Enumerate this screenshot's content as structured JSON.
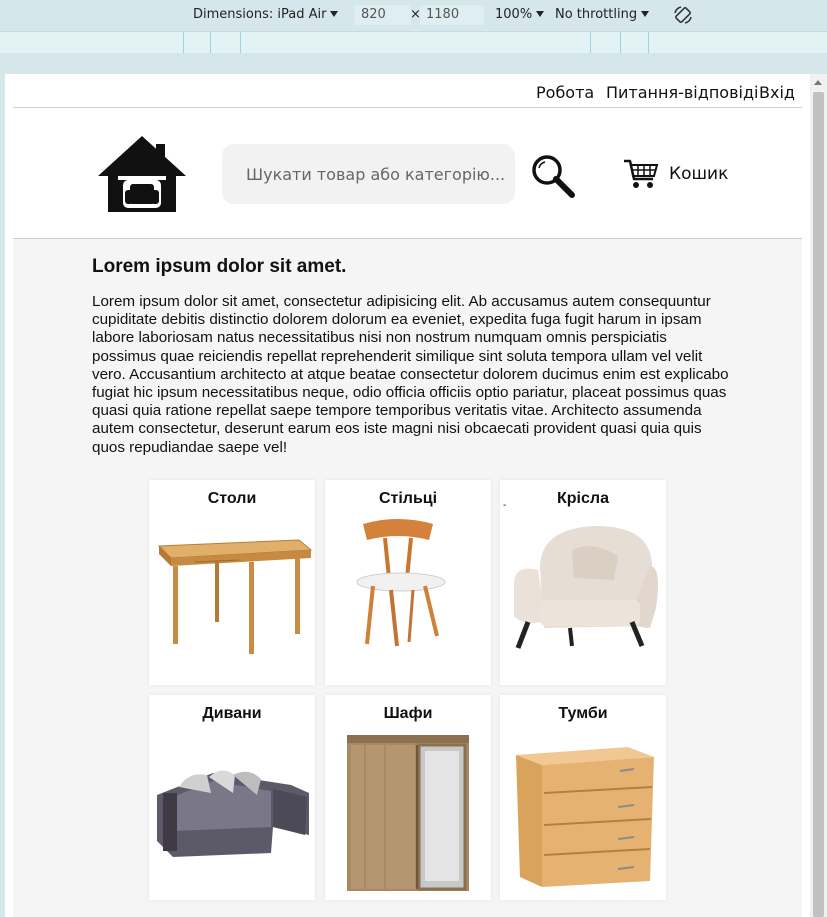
{
  "devtools": {
    "dimensions_label": "Dimensions: iPad Air",
    "width": "820",
    "times": "×",
    "height": "1180",
    "zoom": "100%",
    "throttling": "No throttling",
    "rotate_icon": "rotate-icon"
  },
  "topnav": {
    "links": [
      "Робота",
      "Питання-відповіді",
      "Вхід"
    ]
  },
  "header": {
    "search_placeholder": "Шукати товар або категорію...",
    "cart_label": "Кошик"
  },
  "main": {
    "title": "Lorem ipsum dolor sit amet.",
    "body": "Lorem ipsum dolor sit amet, consectetur adipisicing elit. Ab accusamus autem consequuntur cupiditate debitis distinctio dolorem dolorum ea eveniet, expedita fuga fugit harum in ipsam labore laboriosam natus necessitatibus nisi non nostrum numquam omnis perspiciatis possimus quae reiciendis repellat reprehenderit similique sint soluta tempora ullam vel velit vero. Accusantium architecto at atque beatae consectetur dolorem ducimus enim est explicabo fugiat hic ipsum necessitatibus neque, odio officia officiis optio pariatur, placeat possimus quas quasi quia ratione repellat saepe tempore temporibus veritatis vitae. Architecto assumenda autem consectetur, deserunt earum eos iste magni nisi obcaecati provident quasi quia quis quos repudiandae saepe vel!"
  },
  "categories": [
    {
      "title": "Столи",
      "icon": "table-image"
    },
    {
      "title": "Стільці",
      "icon": "chair-image"
    },
    {
      "title": "Крісла",
      "icon": "armchair-image",
      "mark": "-"
    },
    {
      "title": "Дивани",
      "icon": "sofa-image"
    },
    {
      "title": "Шафи",
      "icon": "wardrobe-image"
    },
    {
      "title": "Тумби",
      "icon": "dresser-image"
    }
  ],
  "colors": {
    "devtools_bg": "#d5e7ea",
    "main_bg": "#f5f5f5",
    "search_bg": "#f2f2f2",
    "wood": "#d9a35c"
  }
}
